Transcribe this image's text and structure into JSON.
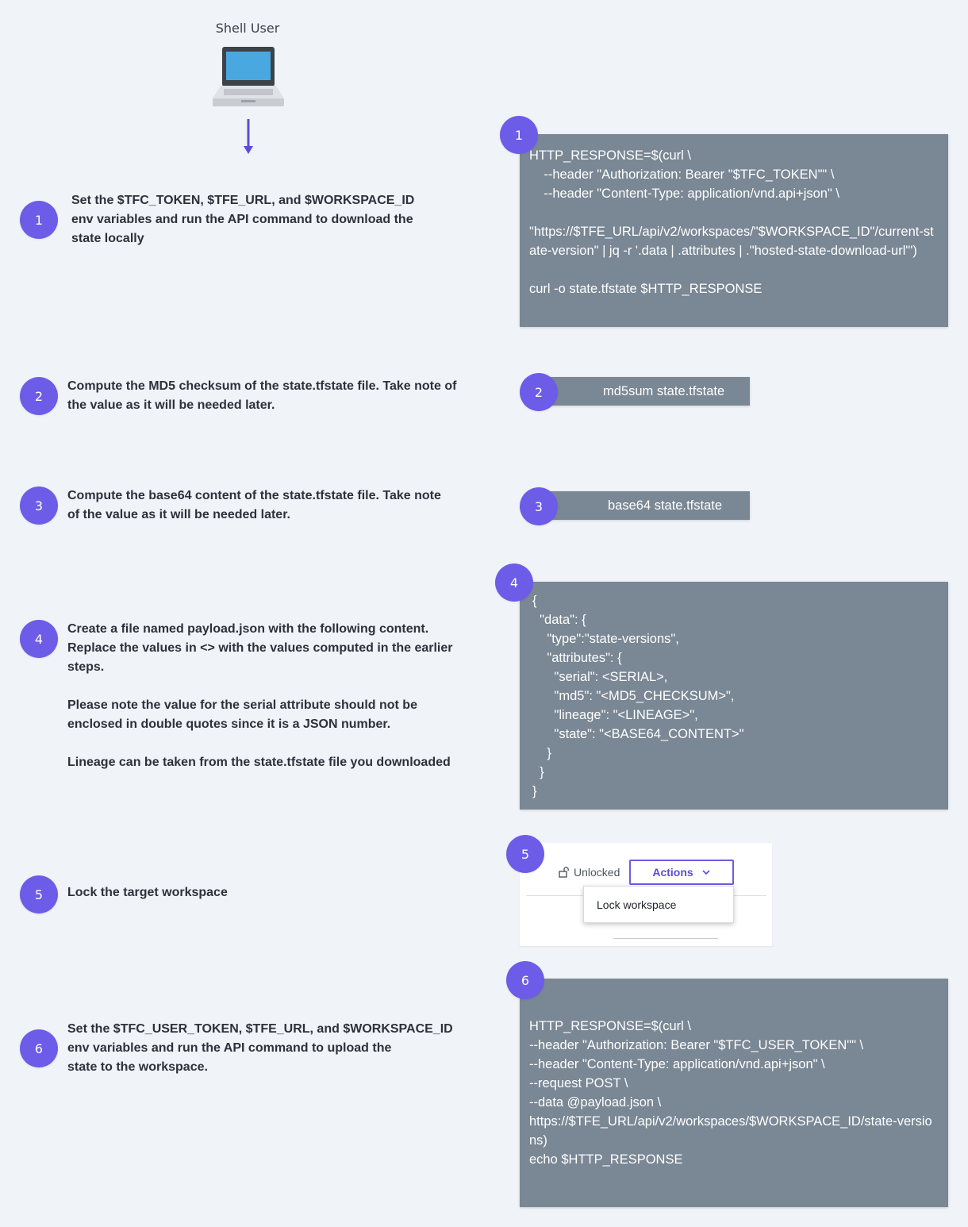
{
  "actor": {
    "label": "Shell User"
  },
  "steps": [
    {
      "number": "1",
      "text": "Set the $TFC_TOKEN, $TFE_URL, and $WORKSPACE_ID\nenv variables and run the API command to download the\nstate locally"
    },
    {
      "number": "2",
      "text": "Compute the MD5 checksum of the state.tfstate file. Take note of\nthe value as it will be needed later."
    },
    {
      "number": "3",
      "text": "Compute the base64 content of the state.tfstate file. Take note\nof the value as it will be needed later."
    },
    {
      "number": "4",
      "text": "Create a file named payload.json with the following content.\nReplace the values in <> with the values computed in the earlier\nsteps.\n\nPlease note the value for the serial attribute should not be\nenclosed in double quotes since it is a JSON number.\n\nLineage can be taken from the state.tfstate file you downloaded"
    },
    {
      "number": "5",
      "text": "Lock the target workspace"
    },
    {
      "number": "6",
      "text": "Set the $TFC_USER_TOKEN, $TFE_URL, and $WORKSPACE_ID\nenv variables and run the API command to upload the\nstate to the workspace."
    }
  ],
  "code": {
    "step1": "HTTP_RESPONSE=$(curl \\\n    --header \"Authorization: Bearer \"$TFC_TOKEN\"\" \\\n    --header \"Content-Type: application/vnd.api+json\" \\\n\n\"https://$TFE_URL/api/v2/workspaces/\"$WORKSPACE_ID\"/current-state-version\" | jq -r '.data | .attributes | .\"hosted-state-download-url\"')\n\ncurl -o state.tfstate $HTTP_RESPONSE",
    "step2": "md5sum state.tfstate",
    "step3": "base64 state.tfstate",
    "step4": "{\n  \"data\": {\n    \"type\":\"state-versions\",\n    \"attributes\": {\n      \"serial\": <SERIAL>,\n      \"md5\": \"<MD5_CHECKSUM>\",\n      \"lineage\": \"<LINEAGE>\",\n      \"state\": \"<BASE64_CONTENT>\"\n    }\n  }\n}",
    "step6": "HTTP_RESPONSE=$(curl \\\n--header \"Authorization: Bearer \"$TFC_USER_TOKEN\"\" \\\n--header \"Content-Type: application/vnd.api+json\" \\\n--request POST \\\n--data @payload.json \\\nhttps://$TFE_URL/api/v2/workspaces/$WORKSPACE_ID/state-versions)\necho $HTTP_RESPONSE"
  },
  "workspace_ui": {
    "status_label": "Unlocked",
    "actions_label": "Actions",
    "menu_item": "Lock workspace"
  },
  "colors": {
    "badge": "#6c5ce8",
    "code_bg": "#7a8794",
    "background": "#f0f3f7"
  },
  "icons": {
    "actor": "laptop-icon",
    "lock": "unlocked-icon",
    "dropdown": "chevron-down-icon",
    "flow": "arrow-down-icon"
  }
}
